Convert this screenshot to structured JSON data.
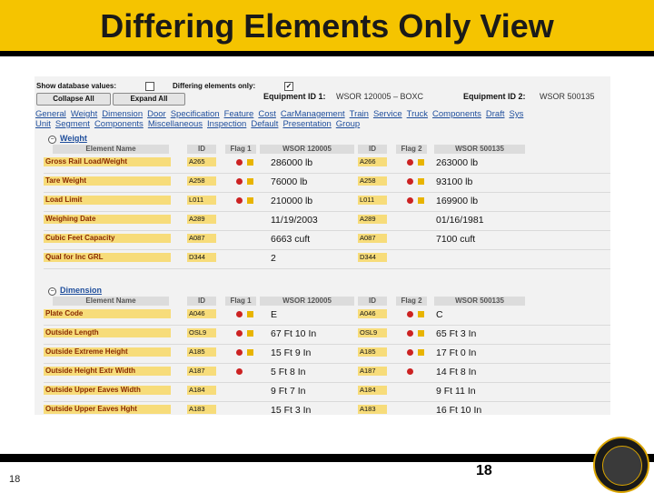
{
  "slide": {
    "title": "Differing Elements Only View",
    "page_number_left": "18",
    "page_number_center": "18"
  },
  "app": {
    "options": {
      "show_db_label": "Show database values:",
      "differing_label": "Differing elements only:",
      "differing_check": "✓"
    },
    "buttons": {
      "collapse": "Collapse All",
      "expand": "Expand All"
    },
    "equipment": {
      "id1_label": "Equipment ID 1:",
      "id1_value": "WSOR 120005 – BOXC",
      "id2_label": "Equipment ID 2:",
      "id2_value": "WSOR 500135"
    },
    "nav_row1": [
      "General",
      "Weight",
      "Dimension",
      "Door",
      "Specification",
      "Feature",
      "Cost",
      "CarManagement",
      "Train",
      "Service",
      "Truck",
      "Components",
      "Draft",
      "Sys"
    ],
    "nav_row2": [
      "Unit",
      "Segment",
      "Components",
      "Miscellaneous",
      "Inspection",
      "Default",
      "Presentation",
      "Group"
    ],
    "columns": {
      "name": "Element Name",
      "id": "ID",
      "flag1": "Flag 1",
      "col1": "WSOR 120005",
      "id2": "ID",
      "flag2": "Flag 2",
      "col2": "WSOR 500135"
    },
    "weight": {
      "title": "Weight",
      "rows": [
        {
          "name": "Gross Rail Load/Weight",
          "id1": "A265",
          "v1": "286000 lb",
          "id2": "A266",
          "v2": "263000 lb"
        },
        {
          "name": "Tare Weight",
          "id1": "A258",
          "v1": "76000 lb",
          "id2": "A258",
          "v2": "93100 lb"
        },
        {
          "name": "Load Limit",
          "id1": "L011",
          "v1": "210000 lb",
          "id2": "L011",
          "v2": "169900 lb"
        },
        {
          "name": "Weighing Date",
          "id1": "A289",
          "v1": "11/19/2003",
          "id2": "A289",
          "v2": "01/16/1981"
        },
        {
          "name": "Cubic Feet Capacity",
          "id1": "A087",
          "v1": "6663 cuft",
          "id2": "A087",
          "v2": "7100 cuft"
        },
        {
          "name": "Qual for Inc GRL",
          "id1": "D344",
          "v1": "2",
          "id2": "D344",
          "v2": ""
        }
      ]
    },
    "dimension": {
      "title": "Dimension",
      "rows": [
        {
          "name": "Plate Code",
          "id1": "A046",
          "v1": "E",
          "id2": "A046",
          "v2": "C"
        },
        {
          "name": "Outside Length",
          "id1": "OSL9",
          "v1": "67 Ft 10 In",
          "id2": "OSL9",
          "v2": "65 Ft 3 In"
        },
        {
          "name": "Outside Extreme Height",
          "id1": "A185",
          "v1": "15 Ft 9 In",
          "id2": "A185",
          "v2": "17 Ft 0 In"
        },
        {
          "name": "Outside Height Extr Width",
          "id1": "A187",
          "v1": "5 Ft 8 In",
          "id2": "A187",
          "v2": "14 Ft 8 In"
        },
        {
          "name": "Outside Upper Eaves Width",
          "id1": "A184",
          "v1": "9 Ft 7 In",
          "id2": "A184",
          "v2": "9 Ft 11 In"
        },
        {
          "name": "Outside Upper Eaves Hght",
          "id1": "A183",
          "v1": "15 Ft 3 In",
          "id2": "A183",
          "v2": "16 Ft 10 In"
        }
      ]
    }
  }
}
